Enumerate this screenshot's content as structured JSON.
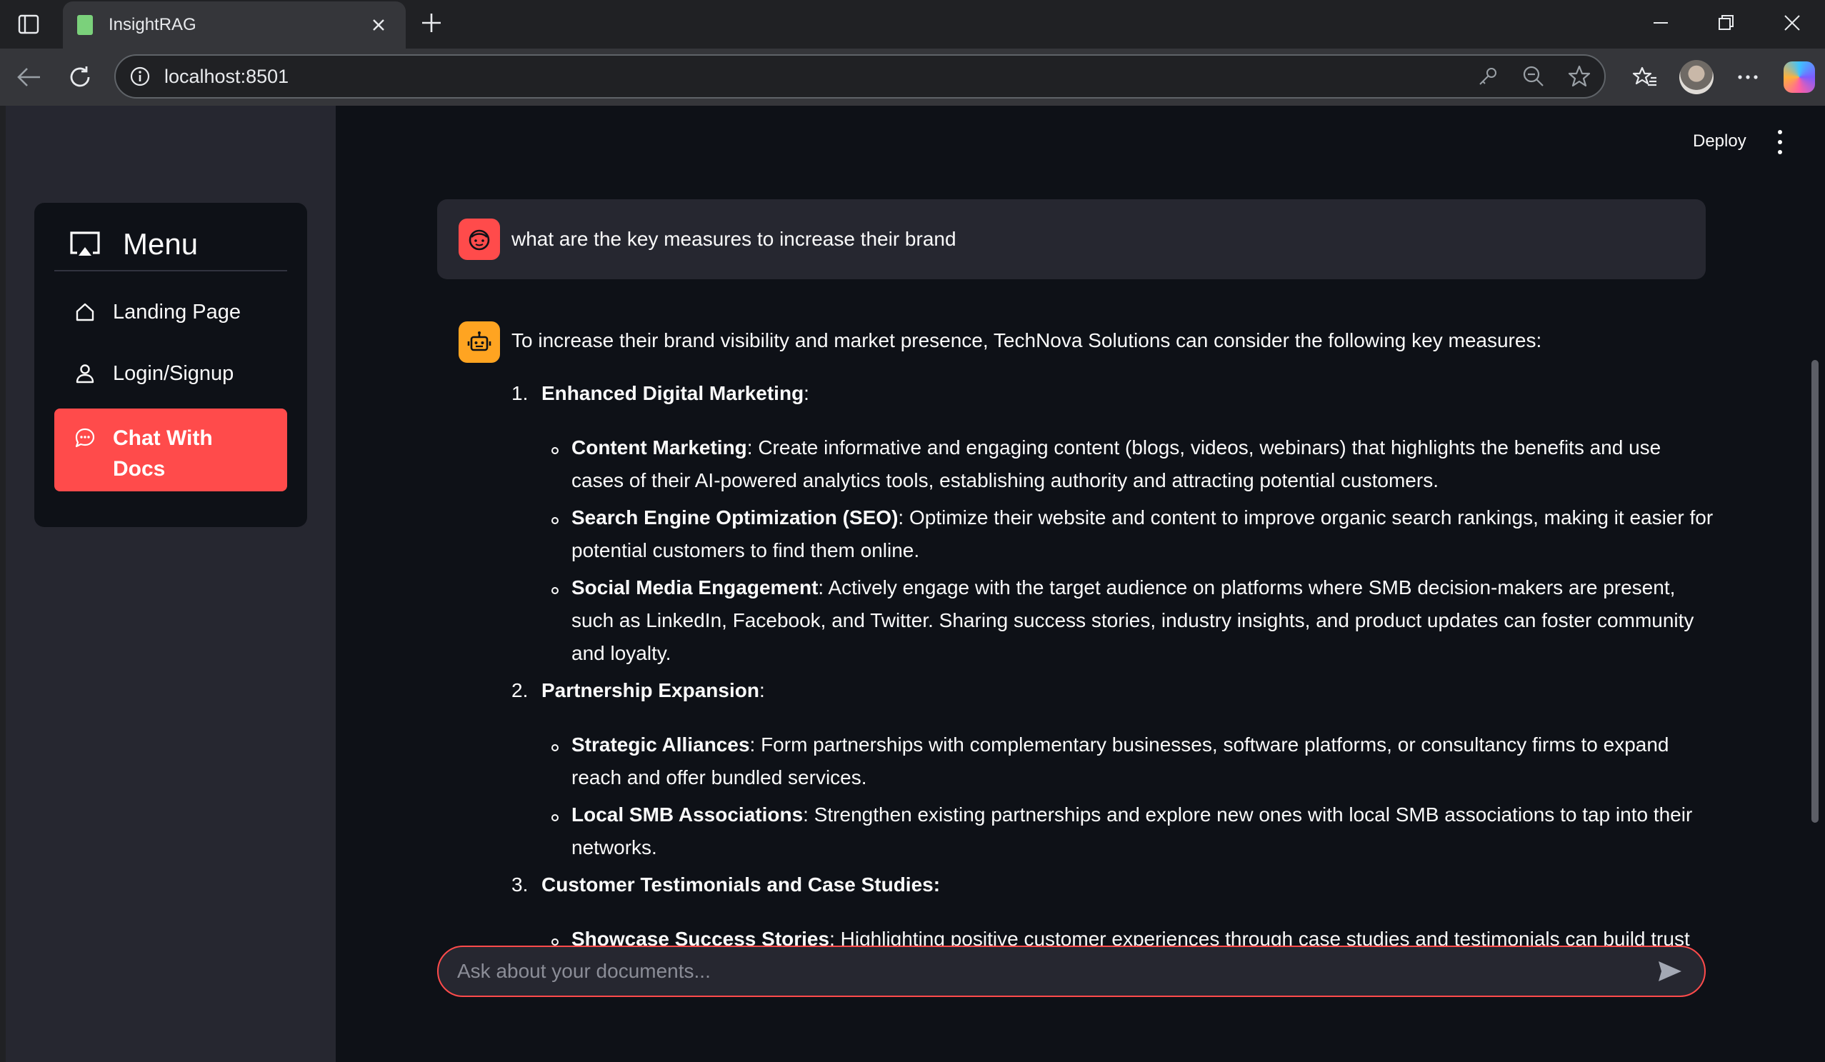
{
  "browser": {
    "tab_title": "InsightRAG",
    "url": "localhost:8501"
  },
  "app": {
    "deploy_label": "Deploy"
  },
  "sidebar": {
    "menu_title": "Menu",
    "items": [
      {
        "label": "Landing Page",
        "icon": "home-icon"
      },
      {
        "label": "Login/Signup",
        "icon": "person-icon"
      },
      {
        "label": "Chat With Docs",
        "icon": "chat-icon",
        "active": true
      }
    ]
  },
  "chat": {
    "user_message": "what are the key measures to increase their brand",
    "assistant": {
      "intro": "To increase their brand visibility and market presence, TechNova Solutions can consider the following key measures:",
      "sections": [
        {
          "num": "1.",
          "title": "Enhanced Digital Marketing",
          "suffix": ":",
          "bullets": [
            {
              "bold": "Content Marketing",
              "text": ": Create informative and engaging content (blogs, videos, webinars) that highlights the benefits and use cases of their AI-powered analytics tools, establishing authority and attracting potential customers."
            },
            {
              "bold": "Search Engine Optimization (SEO)",
              "text": ": Optimize their website and content to improve organic search rankings, making it easier for potential customers to find them online."
            },
            {
              "bold": "Social Media Engagement",
              "text": ": Actively engage with the target audience on platforms where SMB decision-makers are present, such as LinkedIn, Facebook, and Twitter. Sharing success stories, industry insights, and product updates can foster community and loyalty."
            }
          ]
        },
        {
          "num": "2.",
          "title": "Partnership Expansion",
          "suffix": ":",
          "bullets": [
            {
              "bold": "Strategic Alliances",
              "text": ": Form partnerships with complementary businesses, software platforms, or consultancy firms to expand reach and offer bundled services."
            },
            {
              "bold": "Local SMB Associations",
              "text": ": Strengthen existing partnerships and explore new ones with local SMB associations to tap into their networks."
            }
          ]
        },
        {
          "num": "3.",
          "title": "Customer Testimonials and Case Studies:",
          "suffix": "",
          "bullets": [
            {
              "bold": "Showcase Success Stories",
              "text": ": Highlighting positive customer experiences through case studies and testimonials can build trust with"
            }
          ]
        }
      ]
    },
    "input_placeholder": "Ask about your documents..."
  },
  "colors": {
    "accent": "#ff4b4b",
    "bot_avatar": "#ffa421",
    "background": "#0e1117",
    "sidebar": "#262730"
  }
}
